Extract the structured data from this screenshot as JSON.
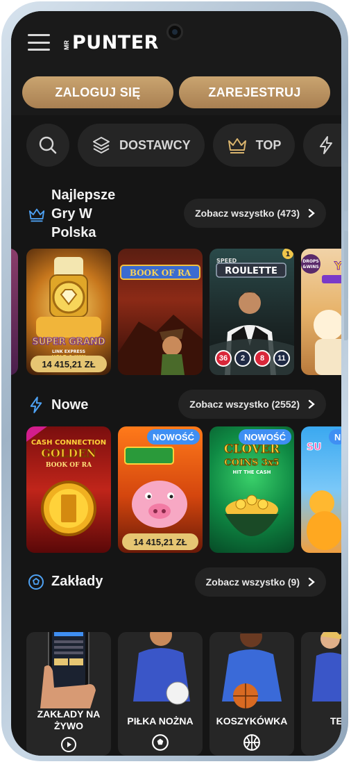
{
  "header": {
    "logo_prefix": "MR",
    "logo_text": "PUNTER",
    "login_label": "ZALOGUJ SIĘ",
    "register_label": "ZAREJESTRUJ"
  },
  "filters": [
    {
      "label": "",
      "icon": "search-icon"
    },
    {
      "label": "DOSTAWCY",
      "icon": "layers-icon"
    },
    {
      "label": "TOP",
      "icon": "crown-icon"
    },
    {
      "label": "",
      "icon": "lightning-icon"
    }
  ],
  "sections": {
    "best": {
      "title": "Najlepsze Gry W Polska",
      "title_lines": [
        "Najlepsze",
        "Gry W",
        "Polska"
      ],
      "see_all": "Zobacz wszystko (473)",
      "icon": "crown-icon",
      "games": [
        {
          "name": "SUPER GRAND",
          "subtitle": "LINK EXPRESS HOLD & WIN",
          "price": "14 415,21 ZŁ"
        },
        {
          "name": "BOOK OF RA"
        },
        {
          "name": "ROULETTE",
          "prefix": "SPEED",
          "numbers": [
            "36",
            "2",
            "8",
            "11"
          ]
        },
        {
          "name": "DROPS & WINS"
        }
      ]
    },
    "new": {
      "title": "Nowe",
      "see_all": "Zobacz wszystko (2552)",
      "icon": "lightning-icon",
      "games": [
        {
          "name": "CASH CONNECTION GOLDEN BOOK OF RA"
        },
        {
          "name": "PIGGY",
          "badge": "NOWOŚĆ",
          "price": "14 415,21 ZŁ"
        },
        {
          "name": "CLOVER COINS 3x5",
          "subtitle": "HIT THE CASH",
          "badge": "NOWOŚĆ"
        },
        {
          "name": "SUGAR",
          "badge": "N"
        }
      ]
    },
    "bets": {
      "title": "Zakłady",
      "see_all": "Zobacz wszystko (9)",
      "icon": "soccer-ball-icon",
      "items": [
        {
          "label_lines": [
            "ZAKŁADY NA",
            "ŻYWO"
          ],
          "icon": "play-icon"
        },
        {
          "label_lines": [
            "PIŁKA NOŻNA"
          ],
          "icon": "soccer-ball-icon"
        },
        {
          "label_lines": [
            "KOSZYKÓWKA"
          ],
          "icon": "basketball-icon"
        },
        {
          "label_lines": [
            "TE"
          ],
          "icon": "tennis-icon"
        }
      ]
    }
  },
  "colors": {
    "background": "#151515",
    "gold_button": "#b58b5a",
    "price_tag": "#e6c673",
    "badge_new": "#3f8ff3",
    "pill": "#252525"
  }
}
